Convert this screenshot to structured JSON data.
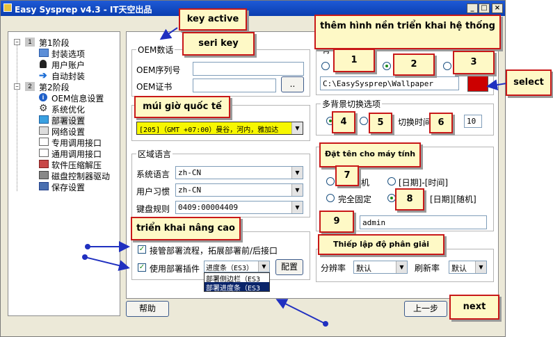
{
  "window": {
    "title": "Easy Sysprep v4.3 - IT天空出品",
    "min": "_",
    "max": "□",
    "close": "×"
  },
  "tree": [
    {
      "text": "第1阶段",
      "num": "1"
    },
    {
      "text": "封装选项"
    },
    {
      "text": "用户账户"
    },
    {
      "text": "自动封装"
    },
    {
      "text": "第2阶段",
      "num": "2"
    },
    {
      "text": "OEM信息设置"
    },
    {
      "text": "系统优化"
    },
    {
      "text": "部署设置"
    },
    {
      "text": "网络设置"
    },
    {
      "text": "专用调用接口"
    },
    {
      "text": "通用调用接口"
    },
    {
      "text": "软件压缩解压"
    },
    {
      "text": "磁盘控制器驱动"
    },
    {
      "text": "保存设置"
    }
  ],
  "oem": {
    "group": "OEM数话",
    "serial_label": "OEM序列号",
    "cert_label": "OEM证书",
    "browse": ".."
  },
  "timezone": {
    "value": "[205]（GMT +07:00）曼谷，河内，雅加达"
  },
  "region": {
    "group": "区域语言",
    "lang_label": "系统语言",
    "lang_value": "zh-CN",
    "habit_label": "用户习惯",
    "habit_value": "zh-CN",
    "kb_label": "键盘规则",
    "kb_value": "0409:00004409"
  },
  "advanced": {
    "takeover": "接管部署流程，拓展部署前/后接口",
    "use_plugin": "使用部署插件",
    "plugin_value": "进度条（ES3）",
    "plugin_options": [
      "部署侧边栏（ES3",
      "部署进度条（ES3"
    ],
    "config": "配置"
  },
  "wallpaper": {
    "group": "背",
    "path": "C:\\EasySysprep\\Wallpaper",
    "color": "#cc0000"
  },
  "multibg": {
    "group": "多背景切换选项",
    "interval_label": "切换时间",
    "interval": "10"
  },
  "computer": {
    "opt_random": "机",
    "opt_datetime": "[日期]-[时间]",
    "opt_fixed": "完全固定",
    "opt_daterandom": "[日期][随机]",
    "name": "admin"
  },
  "resolution": {
    "res_label": "分辨率",
    "res_value": "默认",
    "refresh_label": "刷新率",
    "refresh_value": "默认"
  },
  "buttons": {
    "help": "帮助",
    "back": "上一步"
  },
  "annotations": {
    "key_active": "key active",
    "seri_key": "seri key",
    "wallpaper": "thêm hình nền triển khai hệ thống",
    "select": "select",
    "timezone": "múi giờ quốc tế",
    "advanced": "triển khai nâng cao",
    "computer_name": "Đặt tên cho máy tính",
    "resolution": "Thiếp lập độ phân giải",
    "next": "next",
    "n1": "1",
    "n2": "2",
    "n3": "3",
    "n4": "4",
    "n5": "5",
    "n6": "6",
    "n7": "7",
    "n8": "8",
    "n9": "9"
  }
}
